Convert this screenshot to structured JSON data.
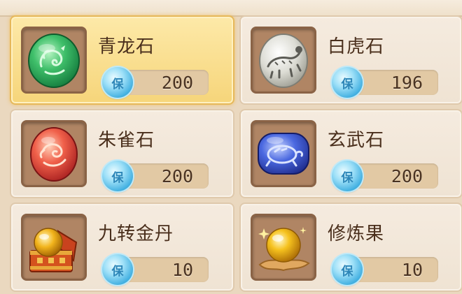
{
  "currency": {
    "icon": "jade-coin-icon",
    "mark": "保",
    "color": "#5cc6ef"
  },
  "items": [
    {
      "name": "青龙石",
      "price": "200",
      "icon": "green-dragon-stone-icon",
      "selected": true
    },
    {
      "name": "白虎石",
      "price": "196",
      "icon": "white-tiger-stone-icon",
      "selected": false
    },
    {
      "name": "朱雀石",
      "price": "200",
      "icon": "vermilion-bird-stone-icon",
      "selected": false
    },
    {
      "name": "玄武石",
      "price": "200",
      "icon": "black-tortoise-stone-icon",
      "selected": false
    },
    {
      "name": "九转金丹",
      "price": "10",
      "icon": "golden-elixir-chest-icon",
      "selected": false
    },
    {
      "name": "修炼果",
      "price": "10",
      "icon": "cultivation-fruit-icon",
      "selected": false
    }
  ],
  "colors": {
    "selected_card": "#f6d57a",
    "card": "#f1e5d6",
    "text": "#4a2f1c"
  }
}
